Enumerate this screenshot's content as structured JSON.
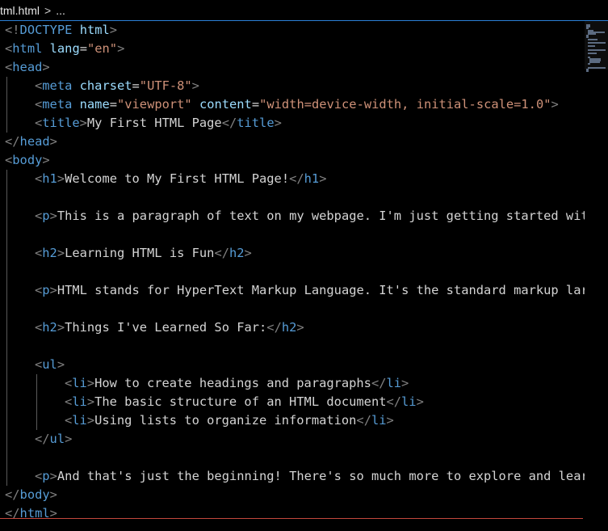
{
  "breadcrumb": {
    "file": "tml.html",
    "separator": ">",
    "more": "..."
  },
  "colors": {
    "background": "#000000",
    "tag": "#569cd6",
    "attribute": "#9cdcfe",
    "string": "#ce9178",
    "text": "#d4d4d4",
    "punctuation": "#808080"
  },
  "lines": [
    {
      "indent": 0,
      "tokens": [
        [
          "p",
          "<!"
        ],
        [
          "tag",
          "DOCTYPE"
        ],
        [
          "t",
          " "
        ],
        [
          "attr",
          "html"
        ],
        [
          "p",
          ">"
        ]
      ]
    },
    {
      "indent": 0,
      "tokens": [
        [
          "p",
          "<"
        ],
        [
          "tag",
          "html"
        ],
        [
          "t",
          " "
        ],
        [
          "attr",
          "lang"
        ],
        [
          "t",
          "="
        ],
        [
          "str",
          "\"en\""
        ],
        [
          "p",
          ">"
        ]
      ]
    },
    {
      "indent": 0,
      "tokens": [
        [
          "p",
          "<"
        ],
        [
          "tag",
          "head"
        ],
        [
          "p",
          ">"
        ]
      ]
    },
    {
      "indent": 1,
      "tokens": [
        [
          "p",
          "<"
        ],
        [
          "tag",
          "meta"
        ],
        [
          "t",
          " "
        ],
        [
          "attr",
          "charset"
        ],
        [
          "t",
          "="
        ],
        [
          "str",
          "\"UTF-8\""
        ],
        [
          "p",
          ">"
        ]
      ]
    },
    {
      "indent": 1,
      "tokens": [
        [
          "p",
          "<"
        ],
        [
          "tag",
          "meta"
        ],
        [
          "t",
          " "
        ],
        [
          "attr",
          "name"
        ],
        [
          "t",
          "="
        ],
        [
          "str",
          "\"viewport\""
        ],
        [
          "t",
          " "
        ],
        [
          "attr",
          "content"
        ],
        [
          "t",
          "="
        ],
        [
          "str",
          "\"width=device-width, initial-scale=1.0\""
        ],
        [
          "p",
          ">"
        ]
      ]
    },
    {
      "indent": 1,
      "tokens": [
        [
          "p",
          "<"
        ],
        [
          "tag",
          "title"
        ],
        [
          "p",
          ">"
        ],
        [
          "t",
          "My First HTML Page"
        ],
        [
          "p",
          "</"
        ],
        [
          "tag",
          "title"
        ],
        [
          "p",
          ">"
        ]
      ]
    },
    {
      "indent": 0,
      "tokens": [
        [
          "p",
          "</"
        ],
        [
          "tag",
          "head"
        ],
        [
          "p",
          ">"
        ]
      ]
    },
    {
      "indent": 0,
      "tokens": [
        [
          "p",
          "<"
        ],
        [
          "tag",
          "body"
        ],
        [
          "p",
          ">"
        ]
      ]
    },
    {
      "indent": 1,
      "tokens": [
        [
          "p",
          "<"
        ],
        [
          "tag",
          "h1"
        ],
        [
          "p",
          ">"
        ],
        [
          "t",
          "Welcome to My First HTML Page!"
        ],
        [
          "p",
          "</"
        ],
        [
          "tag",
          "h1"
        ],
        [
          "p",
          ">"
        ]
      ]
    },
    {
      "indent": 0,
      "tokens": []
    },
    {
      "indent": 1,
      "tokens": [
        [
          "p",
          "<"
        ],
        [
          "tag",
          "p"
        ],
        [
          "p",
          ">"
        ],
        [
          "t",
          "This is a paragraph of text on my webpage. I'm just getting started wit"
        ]
      ]
    },
    {
      "indent": 0,
      "tokens": []
    },
    {
      "indent": 1,
      "tokens": [
        [
          "p",
          "<"
        ],
        [
          "tag",
          "h2"
        ],
        [
          "p",
          ">"
        ],
        [
          "t",
          "Learning HTML is Fun"
        ],
        [
          "p",
          "</"
        ],
        [
          "tag",
          "h2"
        ],
        [
          "p",
          ">"
        ]
      ]
    },
    {
      "indent": 0,
      "tokens": []
    },
    {
      "indent": 1,
      "tokens": [
        [
          "p",
          "<"
        ],
        [
          "tag",
          "p"
        ],
        [
          "p",
          ">"
        ],
        [
          "t",
          "HTML stands for HyperText Markup Language. It's the standard markup lar"
        ]
      ]
    },
    {
      "indent": 0,
      "tokens": []
    },
    {
      "indent": 1,
      "tokens": [
        [
          "p",
          "<"
        ],
        [
          "tag",
          "h2"
        ],
        [
          "p",
          ">"
        ],
        [
          "t",
          "Things I've Learned So Far:"
        ],
        [
          "p",
          "</"
        ],
        [
          "tag",
          "h2"
        ],
        [
          "p",
          ">"
        ]
      ]
    },
    {
      "indent": 0,
      "tokens": []
    },
    {
      "indent": 1,
      "tokens": [
        [
          "p",
          "<"
        ],
        [
          "tag",
          "ul"
        ],
        [
          "p",
          ">"
        ]
      ]
    },
    {
      "indent": 2,
      "tokens": [
        [
          "p",
          "<"
        ],
        [
          "tag",
          "li"
        ],
        [
          "p",
          ">"
        ],
        [
          "t",
          "How to create headings and paragraphs"
        ],
        [
          "p",
          "</"
        ],
        [
          "tag",
          "li"
        ],
        [
          "p",
          ">"
        ]
      ]
    },
    {
      "indent": 2,
      "tokens": [
        [
          "p",
          "<"
        ],
        [
          "tag",
          "li"
        ],
        [
          "p",
          ">"
        ],
        [
          "t",
          "The basic structure of an HTML document"
        ],
        [
          "p",
          "</"
        ],
        [
          "tag",
          "li"
        ],
        [
          "p",
          ">"
        ]
      ]
    },
    {
      "indent": 2,
      "tokens": [
        [
          "p",
          "<"
        ],
        [
          "tag",
          "li"
        ],
        [
          "p",
          ">"
        ],
        [
          "t",
          "Using lists to organize information"
        ],
        [
          "p",
          "</"
        ],
        [
          "tag",
          "li"
        ],
        [
          "p",
          ">"
        ]
      ]
    },
    {
      "indent": 1,
      "tokens": [
        [
          "p",
          "</"
        ],
        [
          "tag",
          "ul"
        ],
        [
          "p",
          ">"
        ]
      ]
    },
    {
      "indent": 0,
      "tokens": []
    },
    {
      "indent": 1,
      "tokens": [
        [
          "p",
          "<"
        ],
        [
          "tag",
          "p"
        ],
        [
          "p",
          ">"
        ],
        [
          "t",
          "And that's just the beginning! There's so much more to explore and lear"
        ]
      ]
    },
    {
      "indent": 0,
      "tokens": [
        [
          "p",
          "</"
        ],
        [
          "tag",
          "body"
        ],
        [
          "p",
          ">"
        ]
      ]
    },
    {
      "indent": 0,
      "tokens": [
        [
          "p",
          "</"
        ],
        [
          "tag",
          "html"
        ],
        [
          "p",
          ">"
        ]
      ]
    }
  ]
}
